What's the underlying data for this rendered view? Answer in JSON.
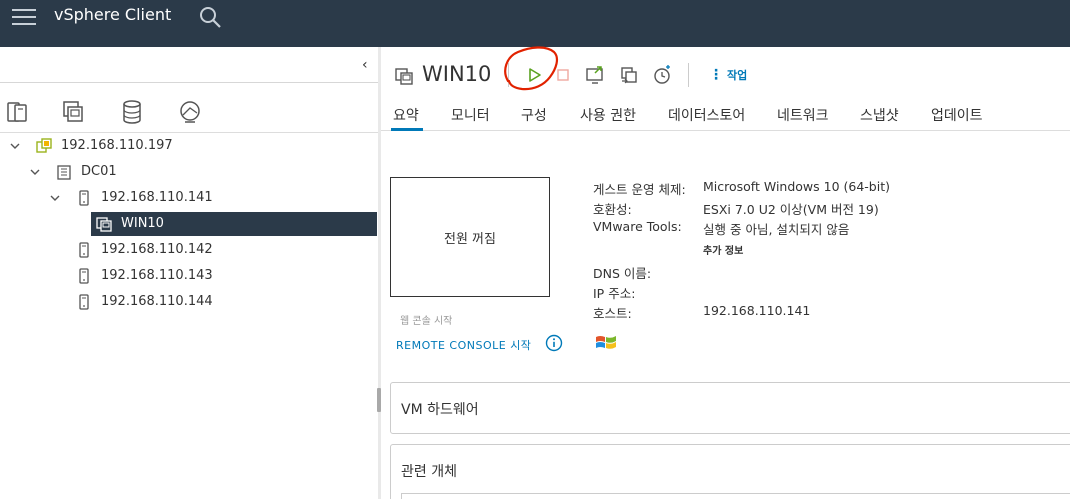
{
  "header": {
    "brand": "vSphere Client",
    "colors": {
      "bar": "#2b3a49",
      "accent": "#0079b8",
      "play_green": "#5aa220",
      "stop_red": "#e12200"
    }
  },
  "nav": {
    "tabs": [
      {
        "name": "hosts-and-clusters-icon"
      },
      {
        "name": "vms-and-templates-icon"
      },
      {
        "name": "storage-icon"
      },
      {
        "name": "networking-icon"
      }
    ],
    "active_tab": 0
  },
  "tree": [
    {
      "label": "192.168.110.197",
      "icon": "vcenter-icon",
      "expanded": true
    },
    {
      "label": "DC01",
      "icon": "datacenter-icon",
      "expanded": true
    },
    {
      "label": "192.168.110.141",
      "icon": "host-icon",
      "expanded": true
    },
    {
      "label": "WIN10",
      "icon": "vm-icon",
      "selected": true
    },
    {
      "label": "192.168.110.142",
      "icon": "host-icon"
    },
    {
      "label": "192.168.110.143",
      "icon": "host-icon"
    },
    {
      "label": "192.168.110.144",
      "icon": "host-icon"
    }
  ],
  "vm": {
    "title": "WIN10",
    "actions_label": "작업",
    "toolbar": [
      "power-on-icon",
      "power-off-icon",
      "launch-console-icon",
      "migrate-icon",
      "snapshot-icon"
    ]
  },
  "tabs": [
    "요약",
    "모니터",
    "구성",
    "사용 권한",
    "데이터스토어",
    "네트워크",
    "스냅샷",
    "업데이트"
  ],
  "summary": {
    "console_state": "전원 꺼짐",
    "web_console": "웹 콘솔 시작",
    "remote_console": "REMOTE CONSOLE 시작",
    "props": [
      {
        "label": "게스트 운영 체제:",
        "value": "Microsoft Windows 10 (64-bit)"
      },
      {
        "label": "호환성:",
        "value": "ESXi 7.0 U2 이상(VM 버전 19)"
      },
      {
        "label": "VMware Tools:",
        "value": "실행 중 아님, 설치되지 않음"
      },
      {
        "label": "DNS 이름:",
        "value": ""
      },
      {
        "label": "IP 주소:",
        "value": ""
      },
      {
        "label": "호스트:",
        "value": "192.168.110.141"
      }
    ],
    "more_info": "추가 정보"
  },
  "cards": [
    "VM 하드웨어",
    "관련 개체"
  ]
}
